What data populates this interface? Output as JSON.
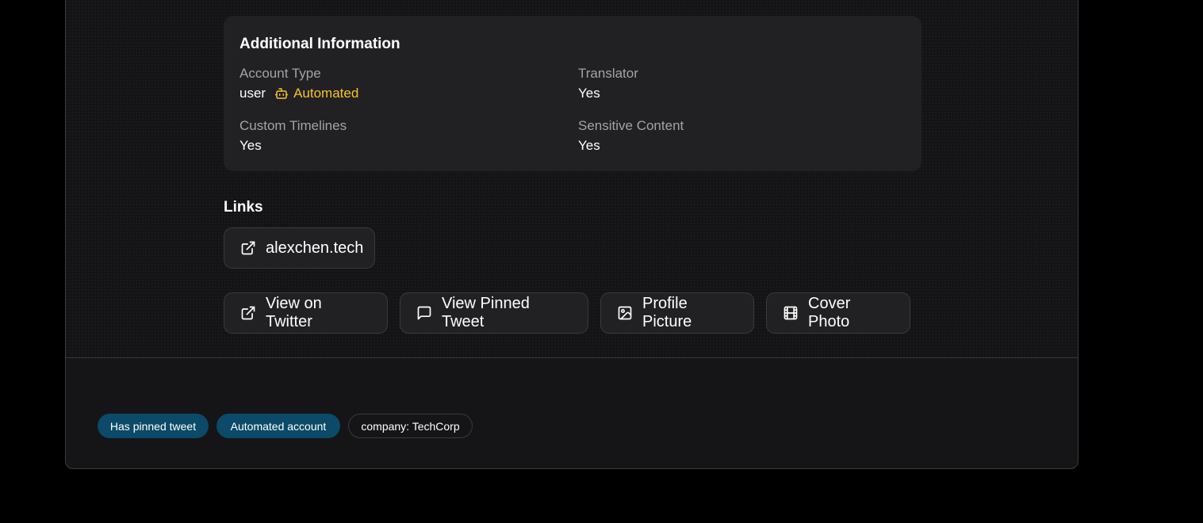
{
  "additional_info": {
    "title": "Additional Information",
    "account_type": {
      "label": "Account Type",
      "value": "user",
      "badge": "Automated",
      "badge_color": "#f4c42a",
      "badge_icon": "bot-icon"
    },
    "translator": {
      "label": "Translator",
      "value": "Yes"
    },
    "custom_timelines": {
      "label": "Custom Timelines",
      "value": "Yes"
    },
    "sensitive_content": {
      "label": "Sensitive Content",
      "value": "Yes"
    }
  },
  "links": {
    "title": "Links",
    "items": [
      {
        "label": "alexchen.tech",
        "icon": "external-link-icon"
      }
    ]
  },
  "actions": {
    "view_twitter": {
      "label": "View on Twitter",
      "icon": "external-link-icon"
    },
    "view_pinned": {
      "label": "View Pinned Tweet",
      "icon": "message-square-icon"
    },
    "profile_picture": {
      "label": "Profile Picture",
      "icon": "image-icon"
    },
    "cover_photo": {
      "label": "Cover Photo",
      "icon": "film-icon"
    }
  },
  "tags": [
    {
      "label": "Has pinned tweet",
      "style": "blue"
    },
    {
      "label": "Automated account",
      "style": "blue"
    },
    {
      "label": "company: TechCorp",
      "style": "outline"
    }
  ],
  "colors": {
    "page_bg": "#000000",
    "card_bg": "#151517",
    "panel_bg": "#212124",
    "tag_blue": "#0b4a68",
    "accent_yellow": "#f4c42a"
  }
}
